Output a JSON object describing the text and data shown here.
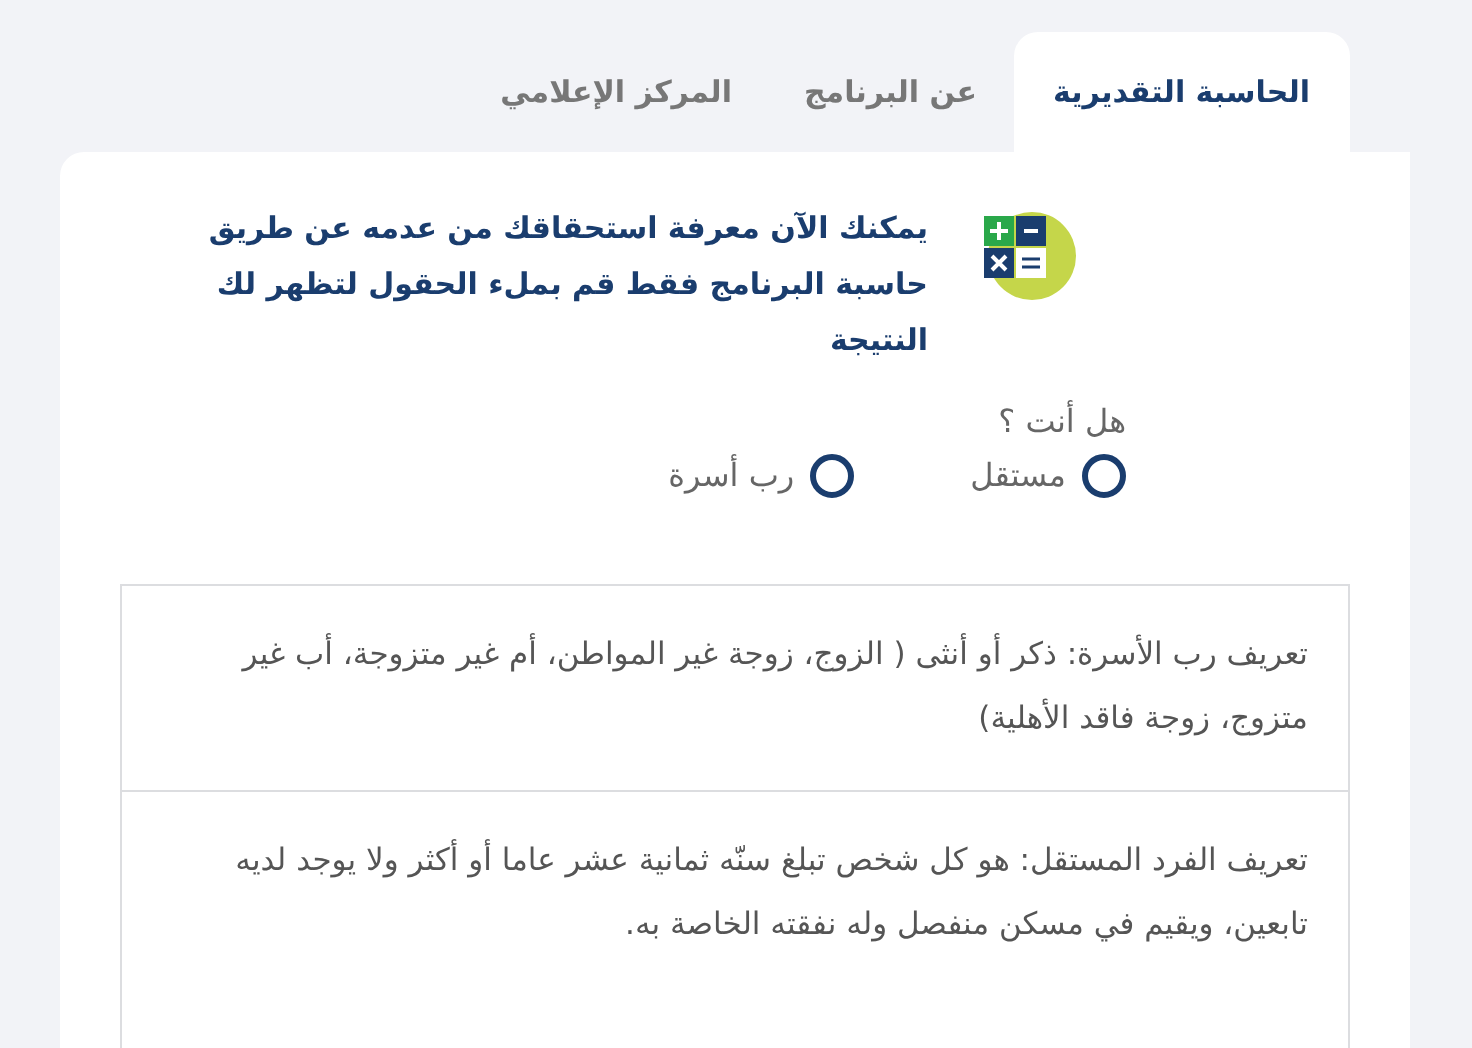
{
  "tabs": [
    {
      "label": "الحاسبة التقديرية",
      "selected": true
    },
    {
      "label": "عن البرنامج",
      "selected": false
    },
    {
      "label": "المركز الإعلامي",
      "selected": false
    }
  ],
  "intro": "يمكنك الآن معرفة استحقاقك من عدمه عن طريق حاسبة البرنامج فقط قم بملء الحقول لتظهر لك النتيجة",
  "question": {
    "label": "هل أنت ؟",
    "options": [
      {
        "label": "مستقل",
        "selected": false
      },
      {
        "label": "رب أسرة",
        "selected": false
      }
    ]
  },
  "definitions": [
    "تعريف رب الأسرة: ذكر أو أنثى ( الزوج، زوجة غير المواطن، أم غير متزوجة، أب غير متزوج، زوجة فاقد الأهلية)",
    "تعريف الفرد المستقل: هو كل شخص تبلغ سنّه ثمانية عشر عاما أو أكثر ولا يوجد لديه تابعين، ويقيم في مسكن منفصل وله نفقته الخاصة به."
  ]
}
